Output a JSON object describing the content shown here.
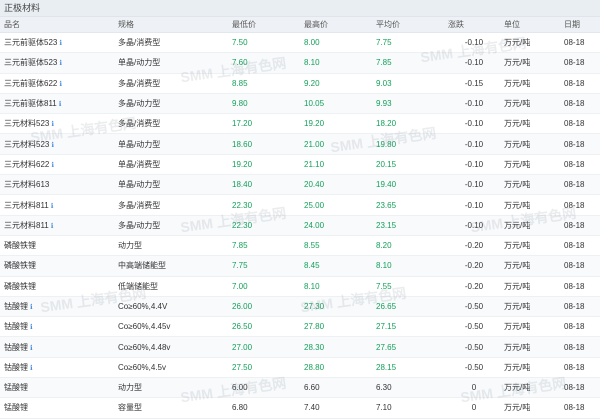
{
  "section_title": "正极材料",
  "columns": {
    "name": "品名",
    "spec": "规格",
    "low": "最低价",
    "high": "最高价",
    "avg": "平均价",
    "change": "涨跌",
    "unit": "单位",
    "date": "日期"
  },
  "rows": [
    {
      "name": "三元前驱体523",
      "info": true,
      "spec": "多晶/消费型",
      "low": "7.50",
      "high": "8.00",
      "avg": "7.75",
      "change": "-0.10",
      "unit": "万元/吨",
      "date": "08-18",
      "color": "green"
    },
    {
      "name": "三元前驱体523",
      "info": true,
      "spec": "单晶/动力型",
      "low": "7.60",
      "high": "8.10",
      "avg": "7.85",
      "change": "-0.10",
      "unit": "万元/吨",
      "date": "08-18",
      "color": "green"
    },
    {
      "name": "三元前驱体622",
      "info": true,
      "spec": "多晶/消费型",
      "low": "8.85",
      "high": "9.20",
      "avg": "9.03",
      "change": "-0.15",
      "unit": "万元/吨",
      "date": "08-18",
      "color": "green"
    },
    {
      "name": "三元前驱体811",
      "info": true,
      "spec": "多晶/动力型",
      "low": "9.80",
      "high": "10.05",
      "avg": "9.93",
      "change": "-0.10",
      "unit": "万元/吨",
      "date": "08-18",
      "color": "green"
    },
    {
      "name": "三元材料523",
      "info": true,
      "spec": "多晶/消费型",
      "low": "17.20",
      "high": "19.20",
      "avg": "18.20",
      "change": "-0.10",
      "unit": "万元/吨",
      "date": "08-18",
      "color": "green"
    },
    {
      "name": "三元材料523",
      "info": true,
      "spec": "单晶/动力型",
      "low": "18.60",
      "high": "21.00",
      "avg": "19.80",
      "change": "-0.10",
      "unit": "万元/吨",
      "date": "08-18",
      "color": "green"
    },
    {
      "name": "三元材料622",
      "info": true,
      "spec": "单晶/消费型",
      "low": "19.20",
      "high": "21.10",
      "avg": "20.15",
      "change": "-0.10",
      "unit": "万元/吨",
      "date": "08-18",
      "color": "green"
    },
    {
      "name": "三元材料613",
      "info": false,
      "spec": "单晶/动力型",
      "low": "18.40",
      "high": "20.40",
      "avg": "19.40",
      "change": "-0.10",
      "unit": "万元/吨",
      "date": "08-18",
      "color": "green"
    },
    {
      "name": "三元材料811",
      "info": true,
      "spec": "多晶/消费型",
      "low": "22.30",
      "high": "25.00",
      "avg": "23.65",
      "change": "-0.10",
      "unit": "万元/吨",
      "date": "08-18",
      "color": "green"
    },
    {
      "name": "三元材料811",
      "info": true,
      "spec": "多晶/动力型",
      "low": "22.30",
      "high": "24.00",
      "avg": "23.15",
      "change": "-0.10",
      "unit": "万元/吨",
      "date": "08-18",
      "color": "green"
    },
    {
      "name": "磷酸铁锂",
      "info": false,
      "spec": "动力型",
      "low": "7.85",
      "high": "8.55",
      "avg": "8.20",
      "change": "-0.20",
      "unit": "万元/吨",
      "date": "08-18",
      "color": "green"
    },
    {
      "name": "磷酸铁锂",
      "info": false,
      "spec": "中高端储能型",
      "low": "7.75",
      "high": "8.45",
      "avg": "8.10",
      "change": "-0.20",
      "unit": "万元/吨",
      "date": "08-18",
      "color": "green"
    },
    {
      "name": "磷酸铁锂",
      "info": false,
      "spec": "低端储能型",
      "low": "7.00",
      "high": "8.10",
      "avg": "7.55",
      "change": "-0.20",
      "unit": "万元/吨",
      "date": "08-18",
      "color": "green"
    },
    {
      "name": "钴酸锂",
      "info": true,
      "spec": "Co≥60%,4.4V",
      "low": "26.00",
      "high": "27.30",
      "avg": "26.65",
      "change": "-0.50",
      "unit": "万元/吨",
      "date": "08-18",
      "color": "green"
    },
    {
      "name": "钴酸锂",
      "info": true,
      "spec": "Co≥60%,4.45v",
      "low": "26.50",
      "high": "27.80",
      "avg": "27.15",
      "change": "-0.50",
      "unit": "万元/吨",
      "date": "08-18",
      "color": "green"
    },
    {
      "name": "钴酸锂",
      "info": true,
      "spec": "Co≥60%,4.48v",
      "low": "27.00",
      "high": "28.30",
      "avg": "27.65",
      "change": "-0.50",
      "unit": "万元/吨",
      "date": "08-18",
      "color": "green"
    },
    {
      "name": "钴酸锂",
      "info": true,
      "spec": "Co≥60%,4.5v",
      "low": "27.50",
      "high": "28.80",
      "avg": "28.15",
      "change": "-0.50",
      "unit": "万元/吨",
      "date": "08-18",
      "color": "green"
    },
    {
      "name": "锰酸锂",
      "info": false,
      "spec": "动力型",
      "low": "6.00",
      "high": "6.60",
      "avg": "6.30",
      "change": "0",
      "unit": "万元/吨",
      "date": "08-18",
      "color": "dark"
    },
    {
      "name": "锰酸锂",
      "info": false,
      "spec": "容量型",
      "low": "6.80",
      "high": "7.40",
      "avg": "7.10",
      "change": "0",
      "unit": "万元/吨",
      "date": "08-18",
      "color": "dark"
    }
  ],
  "watermark_text": "SMM 上海有色网",
  "colors": {
    "green": "#15a05a",
    "dark": "#333333",
    "header_bg": "#eef2f6"
  }
}
